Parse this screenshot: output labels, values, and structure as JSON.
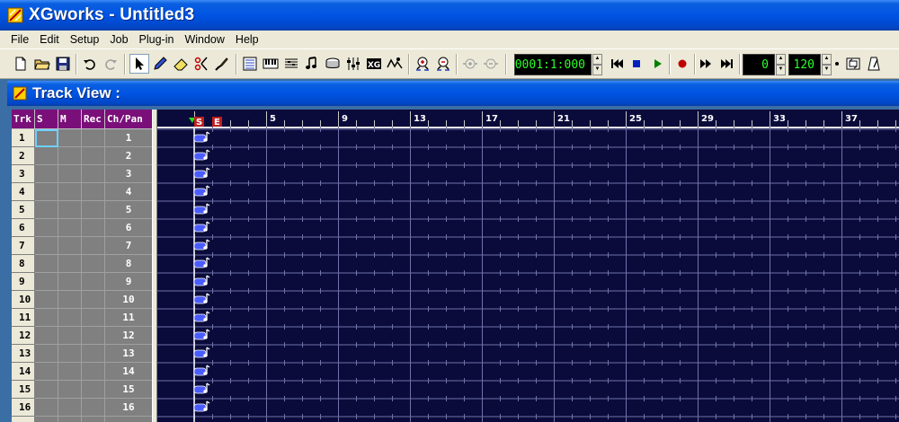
{
  "window": {
    "title": "XGworks - Untitled3"
  },
  "menu": [
    "File",
    "Edit",
    "Setup",
    "Job",
    "Plug-in",
    "Window",
    "Help"
  ],
  "toolbar": {
    "buttons": [
      "new-file-icon",
      "open-folder-icon",
      "save-icon",
      "undo-icon",
      "redo-icon",
      "pointer-tool-icon",
      "pencil-tool-icon",
      "eraser-tool-icon",
      "scissors-tool-icon",
      "brush-tool-icon",
      "list-view-icon",
      "piano-roll-icon",
      "staff-view-icon",
      "score-icon",
      "drum-icon",
      "mixer-icon",
      "xg-editor-icon",
      "wave-icon",
      "zoom-in-icon",
      "zoom-out-icon",
      "zoom-in-h-icon",
      "zoom-out-h-icon"
    ],
    "position": "0001:1:000",
    "transport": [
      "rewind-start-icon",
      "rewind-icon",
      "stop-icon",
      "play-icon",
      "record-icon",
      "fast-forward-icon",
      "forward-end-icon"
    ],
    "transpose": "0",
    "tempo": "120"
  },
  "track_view": {
    "title": "Track View :",
    "columns": [
      "Trk",
      "S",
      "M",
      "Rec",
      "Ch/Pan"
    ],
    "tracks": [
      {
        "trk": "1",
        "ch": "1"
      },
      {
        "trk": "2",
        "ch": "2"
      },
      {
        "trk": "3",
        "ch": "3"
      },
      {
        "trk": "4",
        "ch": "4"
      },
      {
        "trk": "5",
        "ch": "5"
      },
      {
        "trk": "6",
        "ch": "6"
      },
      {
        "trk": "7",
        "ch": "7"
      },
      {
        "trk": "8",
        "ch": "8"
      },
      {
        "trk": "9",
        "ch": "9"
      },
      {
        "trk": "10",
        "ch": "10"
      },
      {
        "trk": "11",
        "ch": "11"
      },
      {
        "trk": "12",
        "ch": "12"
      },
      {
        "trk": "13",
        "ch": "13"
      },
      {
        "trk": "14",
        "ch": "14"
      },
      {
        "trk": "15",
        "ch": "15"
      },
      {
        "trk": "16",
        "ch": "16"
      }
    ],
    "ruler_labels": [
      "5",
      "9",
      "13",
      "17",
      "21",
      "25",
      "29",
      "33",
      "37"
    ],
    "start_marker": "S",
    "end_marker": "E"
  },
  "colors": {
    "grid_bg": "#0b0b3b",
    "grid_line": "#6f73a8",
    "header_bg": "#7a0f7a",
    "lcd_text": "#2aff2a",
    "title_blue": "#0054e3"
  }
}
